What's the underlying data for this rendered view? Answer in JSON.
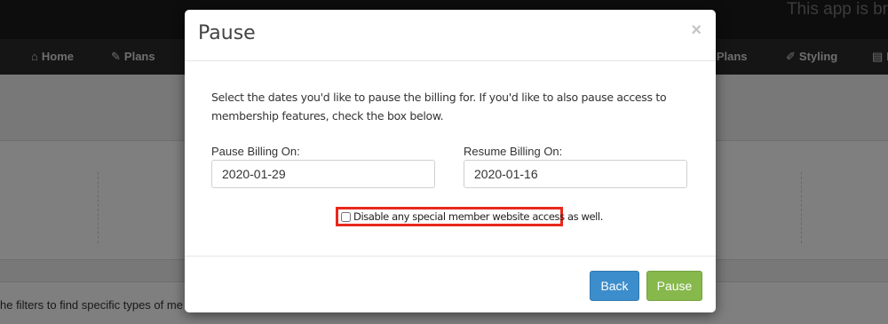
{
  "app": {
    "banner_text": "This app is br",
    "nav": [
      {
        "label": "Home",
        "icon": "home-icon",
        "glyph": "⌂"
      },
      {
        "label": "Plans",
        "icon": "edit-icon",
        "glyph": "✎"
      },
      {
        "label": "e Plans",
        "icon": "",
        "glyph": ""
      },
      {
        "label": "Styling",
        "icon": "brush-icon",
        "glyph": "✐"
      },
      {
        "label": "B",
        "icon": "document-icon",
        "glyph": "▤"
      }
    ],
    "filter_hint": "he filters to find specific types of me"
  },
  "modal": {
    "title": "Pause",
    "close_symbol": "×",
    "intro": "Select the dates you'd like to pause the billing for. If you'd like to also pause access to membership features, check the box below.",
    "pause_label": "Pause Billing On:",
    "pause_value": "2020-01-29",
    "resume_label": "Resume Billing On:",
    "resume_value": "2020-01-16",
    "checkbox_label": "Disable any special member website access as well.",
    "checkbox_checked": false,
    "highlight_color": "#e8281c",
    "back_label": "Back",
    "pause_button_label": "Pause",
    "colors": {
      "back": "#3c8dcb",
      "pause": "#86b84c"
    }
  }
}
